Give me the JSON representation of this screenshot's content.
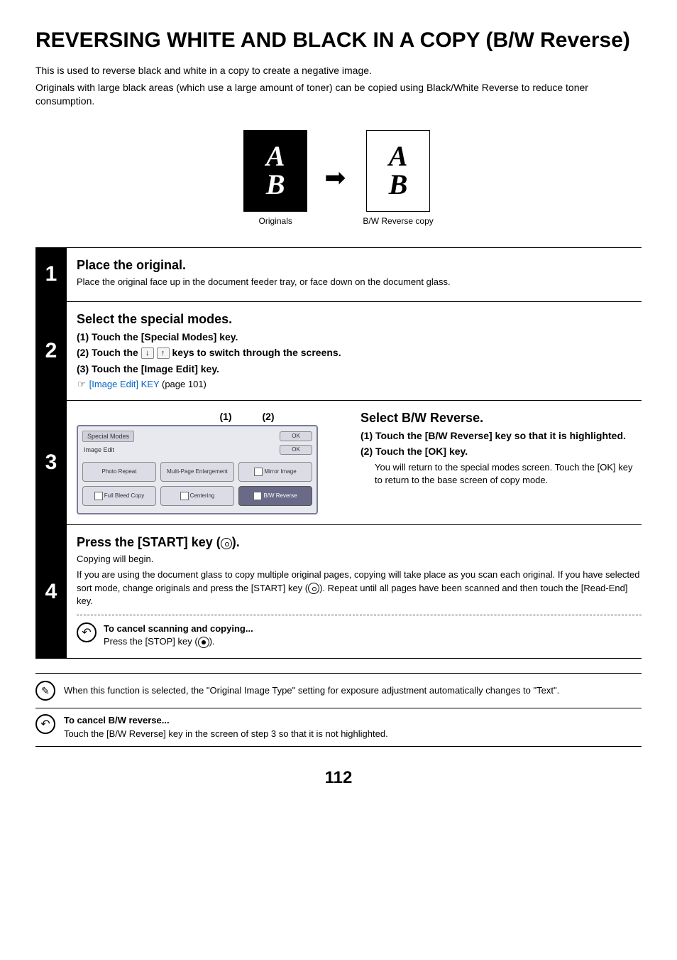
{
  "title": "REVERSING WHITE AND BLACK IN A COPY (B/W Reverse)",
  "intro1": "This is used to reverse black and white in a copy to create a negative image.",
  "intro2": "Originals with large black areas (which use a large amount of toner) can be copied using Black/White Reverse to reduce toner consumption.",
  "figure": {
    "letterA": "A",
    "letterB": "B",
    "cap1": "Originals",
    "cap2": "B/W Reverse copy"
  },
  "steps": {
    "s1": {
      "num": "1",
      "title": "Place the original.",
      "body": "Place the original face up in the document feeder tray, or face down on the document glass."
    },
    "s2": {
      "num": "2",
      "title": "Select the special modes.",
      "l1": "(1)  Touch the [Special Modes] key.",
      "l2a": "(2)  Touch the ",
      "l2b": " keys to switch through the screens.",
      "l3": "(3)  Touch the [Image Edit] key.",
      "link": "[Image Edit] KEY",
      "linkpage": " (page 101)",
      "hand": "☞"
    },
    "s3": {
      "num": "3",
      "label1": "(1)",
      "label2": "(2)",
      "panel": {
        "breadcrumb": "Special Modes",
        "ok": "OK",
        "sublabel": "Image Edit",
        "ok2": "OK",
        "btn1": "Photo Repeat",
        "btn2": "Multi-Page Enlargement",
        "btn3": "Mirror Image",
        "btn4": "Full Bleed Copy",
        "btn5": "Centering",
        "btn6": "B/W Reverse"
      },
      "title": "Select B/W Reverse.",
      "r1": "(1)  Touch the [B/W Reverse] key so that it is highlighted.",
      "r2": "(2)  Touch the [OK] key.",
      "r2desc": "You will return to the special modes screen. Touch the [OK] key to return to the base screen of copy mode."
    },
    "s4": {
      "num": "4",
      "title_a": "Press the [START] key (",
      "title_b": ").",
      "l1": "Copying will begin.",
      "l2a": "If you are using the document glass to copy multiple original pages, copying will take place as you scan each original. If you have selected sort mode, change originals and press the [START] key (",
      "l2b": "). Repeat until all pages have been scanned and then touch the [Read-End] key.",
      "cancel_t": "To cancel scanning and copying...",
      "cancel_b_a": "Press the [STOP] key (",
      "cancel_b_b": ")."
    }
  },
  "note1": "When this function is selected, the \"Original Image Type\" setting for exposure adjustment automatically changes to \"Text\".",
  "note2_t": "To cancel B/W reverse...",
  "note2_b": "Touch the [B/W Reverse] key in the screen of step 3 so that it is not highlighted.",
  "pagenum": "112"
}
